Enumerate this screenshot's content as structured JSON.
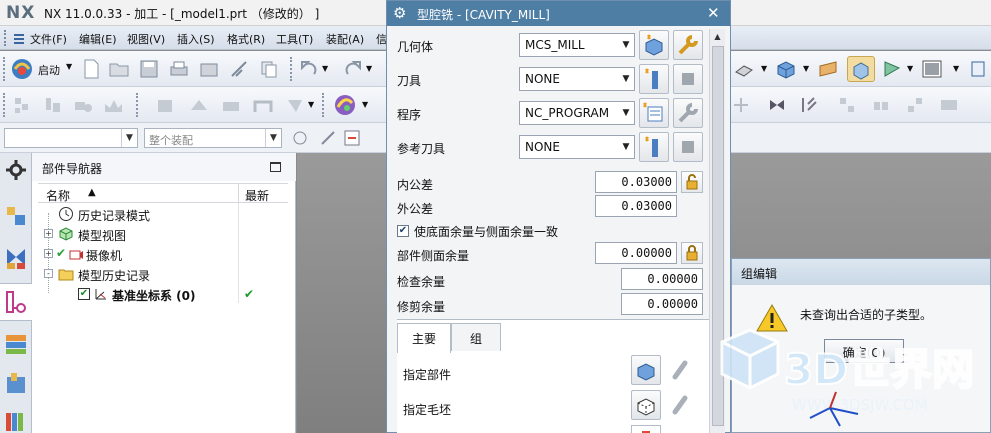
{
  "app": {
    "logo": "NX",
    "title": "NX 11.0.0.33 - 加工 - [_model1.prt （修改的） ]"
  },
  "menubar": {
    "items": [
      "文件(F)",
      "编辑(E)",
      "视图(V)",
      "插入(S)",
      "格式(R)",
      "工具(T)",
      "装配(A)",
      "信"
    ]
  },
  "toolbar": {
    "start_label": "启动",
    "assembly_combo_placeholder": "整个装配"
  },
  "navigator": {
    "title": "部件导航器",
    "col_name": "名称",
    "col_latest": "最新",
    "items": [
      {
        "label": "历史记录模式",
        "icon": "clock-icon",
        "expand": ""
      },
      {
        "label": "模型视图",
        "icon": "model-view-icon",
        "expand": "+"
      },
      {
        "label": "摄像机",
        "icon": "camera-icon",
        "expand": "+"
      },
      {
        "label": "模型历史记录",
        "icon": "folder-icon",
        "expand": "-"
      },
      {
        "label": "基准坐标系 (0)",
        "icon": "datum-csys-icon",
        "expand": ""
      }
    ],
    "latest_check": "✔"
  },
  "dialog": {
    "title": "型腔铣 - [CAVITY_MILL]",
    "geometry_label": "几何体",
    "geometry_value": "MCS_MILL",
    "tool_label": "刀具",
    "tool_value": "NONE",
    "program_label": "程序",
    "program_value": "NC_PROGRAM",
    "ref_tool_label": "参考刀具",
    "ref_tool_value": "NONE",
    "intol_label": "内公差",
    "intol_value": "0.03000",
    "outtol_label": "外公差",
    "outtol_value": "0.03000",
    "floor_same_label": "使底面余量与侧面余量一致",
    "side_stock_label": "部件侧面余量",
    "side_stock_value": "0.00000",
    "check_stock_label": "检查余量",
    "check_stock_value": "0.00000",
    "trim_stock_label": "修剪余量",
    "trim_stock_value": "0.00000",
    "tab_main": "主要",
    "tab_group": "组",
    "specify_part_label": "指定部件",
    "specify_blank_label": "指定毛坯"
  },
  "msgbox": {
    "title": "组编辑",
    "message": "未查询出合适的子类型。",
    "ok_label": "确定(O)"
  },
  "watermark": {
    "brand": "3D世界网",
    "url": "WWW.3DSJW.COM"
  },
  "colors": {
    "dialog_title": "#4f7ea5",
    "accent": "#2f6fb3"
  }
}
